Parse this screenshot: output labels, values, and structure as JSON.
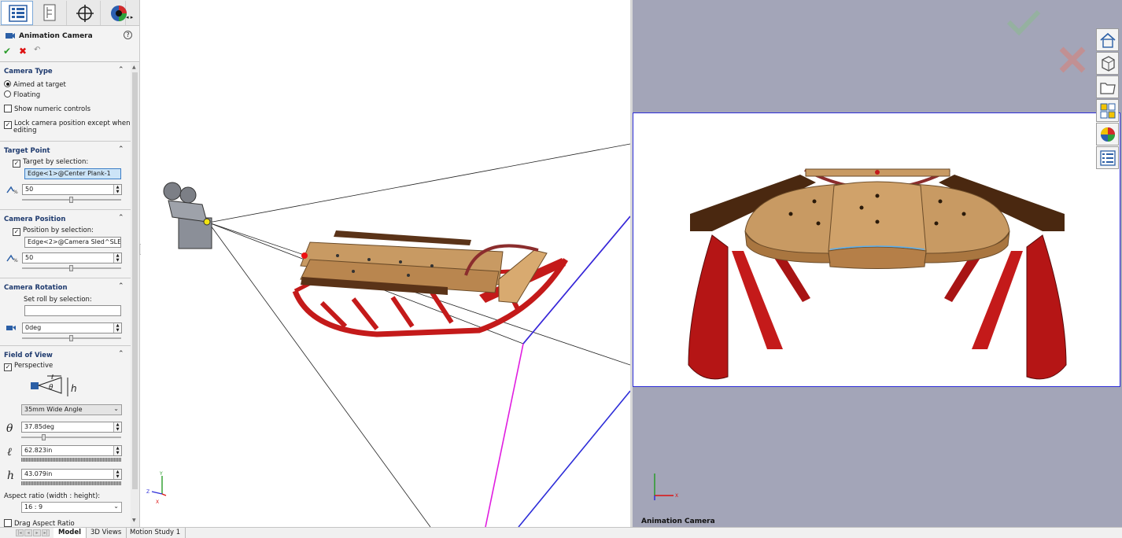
{
  "property_manager": {
    "title": "Animation Camera",
    "help": "?",
    "ok_glyph": "✔",
    "cancel_glyph": "✖",
    "undo_glyph": "↶",
    "camera_type": {
      "title": "Camera Type",
      "aimed_label": "Aimed at target",
      "floating_label": "Floating",
      "selected": "Aimed at target",
      "show_numeric_label": "Show numeric controls",
      "show_numeric_checked": false,
      "lock_label_1": "Lock camera position except when",
      "lock_label_2": "editing",
      "lock_checked": true
    },
    "target_point": {
      "title": "Target Point",
      "target_by_selection_label": "Target by selection:",
      "target_by_selection_checked": true,
      "selection": "Edge<1>@Center Plank-1",
      "value": "50",
      "slider_level_percent": 50
    },
    "camera_position": {
      "title": "Camera Position",
      "position_by_selection_label": "Position by selection:",
      "position_by_selection_checked": true,
      "selection": "Edge<2>@Camera Sled^SLED-",
      "value": "50",
      "slider_level_percent": 50
    },
    "camera_rotation": {
      "title": "Camera Rotation",
      "set_roll_label": "Set roll by selection:",
      "roll_selection": "",
      "value": "0deg",
      "slider_level_percent": 50
    },
    "field_of_view": {
      "title": "Field of View",
      "perspective_label": "Perspective",
      "perspective_checked": true,
      "lens_preset": "35mm Wide Angle",
      "theta_symbol": "θ",
      "theta_value": "37.85deg",
      "theta_slider_percent": 22,
      "l_symbol": "ℓ",
      "l_value": "62.823in",
      "h_symbol": "h",
      "h_value": "43.079in",
      "aspect_label": "Aspect ratio (width : height):",
      "aspect_value": "16 : 9",
      "drag_aspect_label": "Drag Aspect Ratio"
    },
    "collapse_glyph": "⌃"
  },
  "camera_view": {
    "label": "Animation Camera"
  },
  "bottom_tabs": [
    "Model",
    "3D Views",
    "Motion Study 1"
  ],
  "active_tab": "Model",
  "colors": {
    "sled_wood": "#c89a63",
    "sled_runner": "#c41a1a",
    "viewport_bg": "#a3a5b8",
    "frame_blue": "#2d2dd8",
    "frame_magenta": "#e01ee0"
  },
  "icons": [
    "feature-manager-icon",
    "property-manager-icon",
    "config-manager-icon",
    "dim-xpert-icon",
    "display-manager-icon",
    "camera-icon",
    "help-icon",
    "home-icon",
    "3d-content-icon",
    "folder-icon",
    "view-palette-icon",
    "appearances-icon",
    "custom-properties-icon",
    "triad-icon"
  ]
}
